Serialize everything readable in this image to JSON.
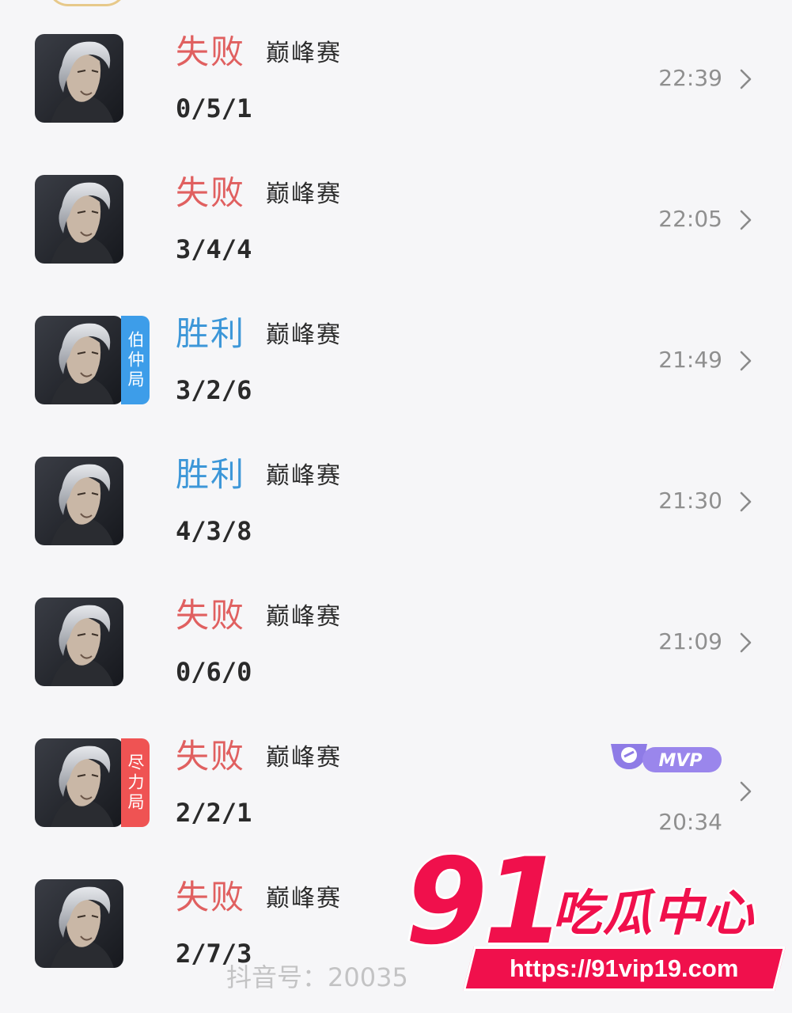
{
  "colors": {
    "loss": "#e06060",
    "win": "#3d97d8",
    "tag_blue": "#3d9de9",
    "tag_red": "#ef5353",
    "brand": "#f0104c"
  },
  "matches": [
    {
      "result": "失败",
      "result_type": "loss",
      "mode": "巅峰赛",
      "kda": "0/5/1",
      "time": "22:39",
      "tag": null,
      "mvp": false
    },
    {
      "result": "失败",
      "result_type": "loss",
      "mode": "巅峰赛",
      "kda": "3/4/4",
      "time": "22:05",
      "tag": null,
      "mvp": false
    },
    {
      "result": "胜利",
      "result_type": "win",
      "mode": "巅峰赛",
      "kda": "3/2/6",
      "time": "21:49",
      "tag": "伯仲局",
      "tag_color": "blue",
      "mvp": false
    },
    {
      "result": "胜利",
      "result_type": "win",
      "mode": "巅峰赛",
      "kda": "4/3/8",
      "time": "21:30",
      "tag": null,
      "mvp": false
    },
    {
      "result": "失败",
      "result_type": "loss",
      "mode": "巅峰赛",
      "kda": "0/6/0",
      "time": "21:09",
      "tag": null,
      "mvp": false
    },
    {
      "result": "失败",
      "result_type": "loss",
      "mode": "巅峰赛",
      "kda": "2/2/1",
      "time": "20:34",
      "tag": "尽力局",
      "tag_color": "red",
      "mvp": true
    },
    {
      "result": "失败",
      "result_type": "loss",
      "mode": "巅峰赛",
      "kda": "2/7/3",
      "time": "",
      "tag": null,
      "mvp": false
    }
  ],
  "mvp_badge": {
    "label": "MVP"
  },
  "watermark": {
    "text": "抖音号：20035"
  },
  "brand": {
    "number": "91",
    "name": "吃瓜中心",
    "url": "https://91vip19.com"
  }
}
